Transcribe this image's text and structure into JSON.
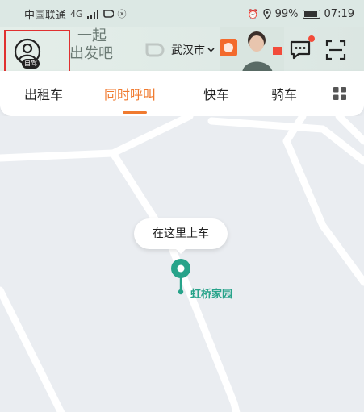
{
  "status_bar": {
    "carrier": "中国联通",
    "network": "4G",
    "battery": "99%",
    "time": "07:19"
  },
  "header": {
    "badge": "自驾",
    "slogan_line1": "一起",
    "slogan_line2": "出发吧",
    "city": "武汉市"
  },
  "tabs": [
    {
      "label": "出租车"
    },
    {
      "label": "同时呼叫"
    },
    {
      "label": "快车"
    },
    {
      "label": "骑车"
    }
  ],
  "map": {
    "pickup_tooltip": "在这里上车",
    "poi_name": "虹桥家园"
  },
  "colors": {
    "accent": "#f07a2f",
    "pin": "#27a38a",
    "highlight_box": "#e03030"
  }
}
